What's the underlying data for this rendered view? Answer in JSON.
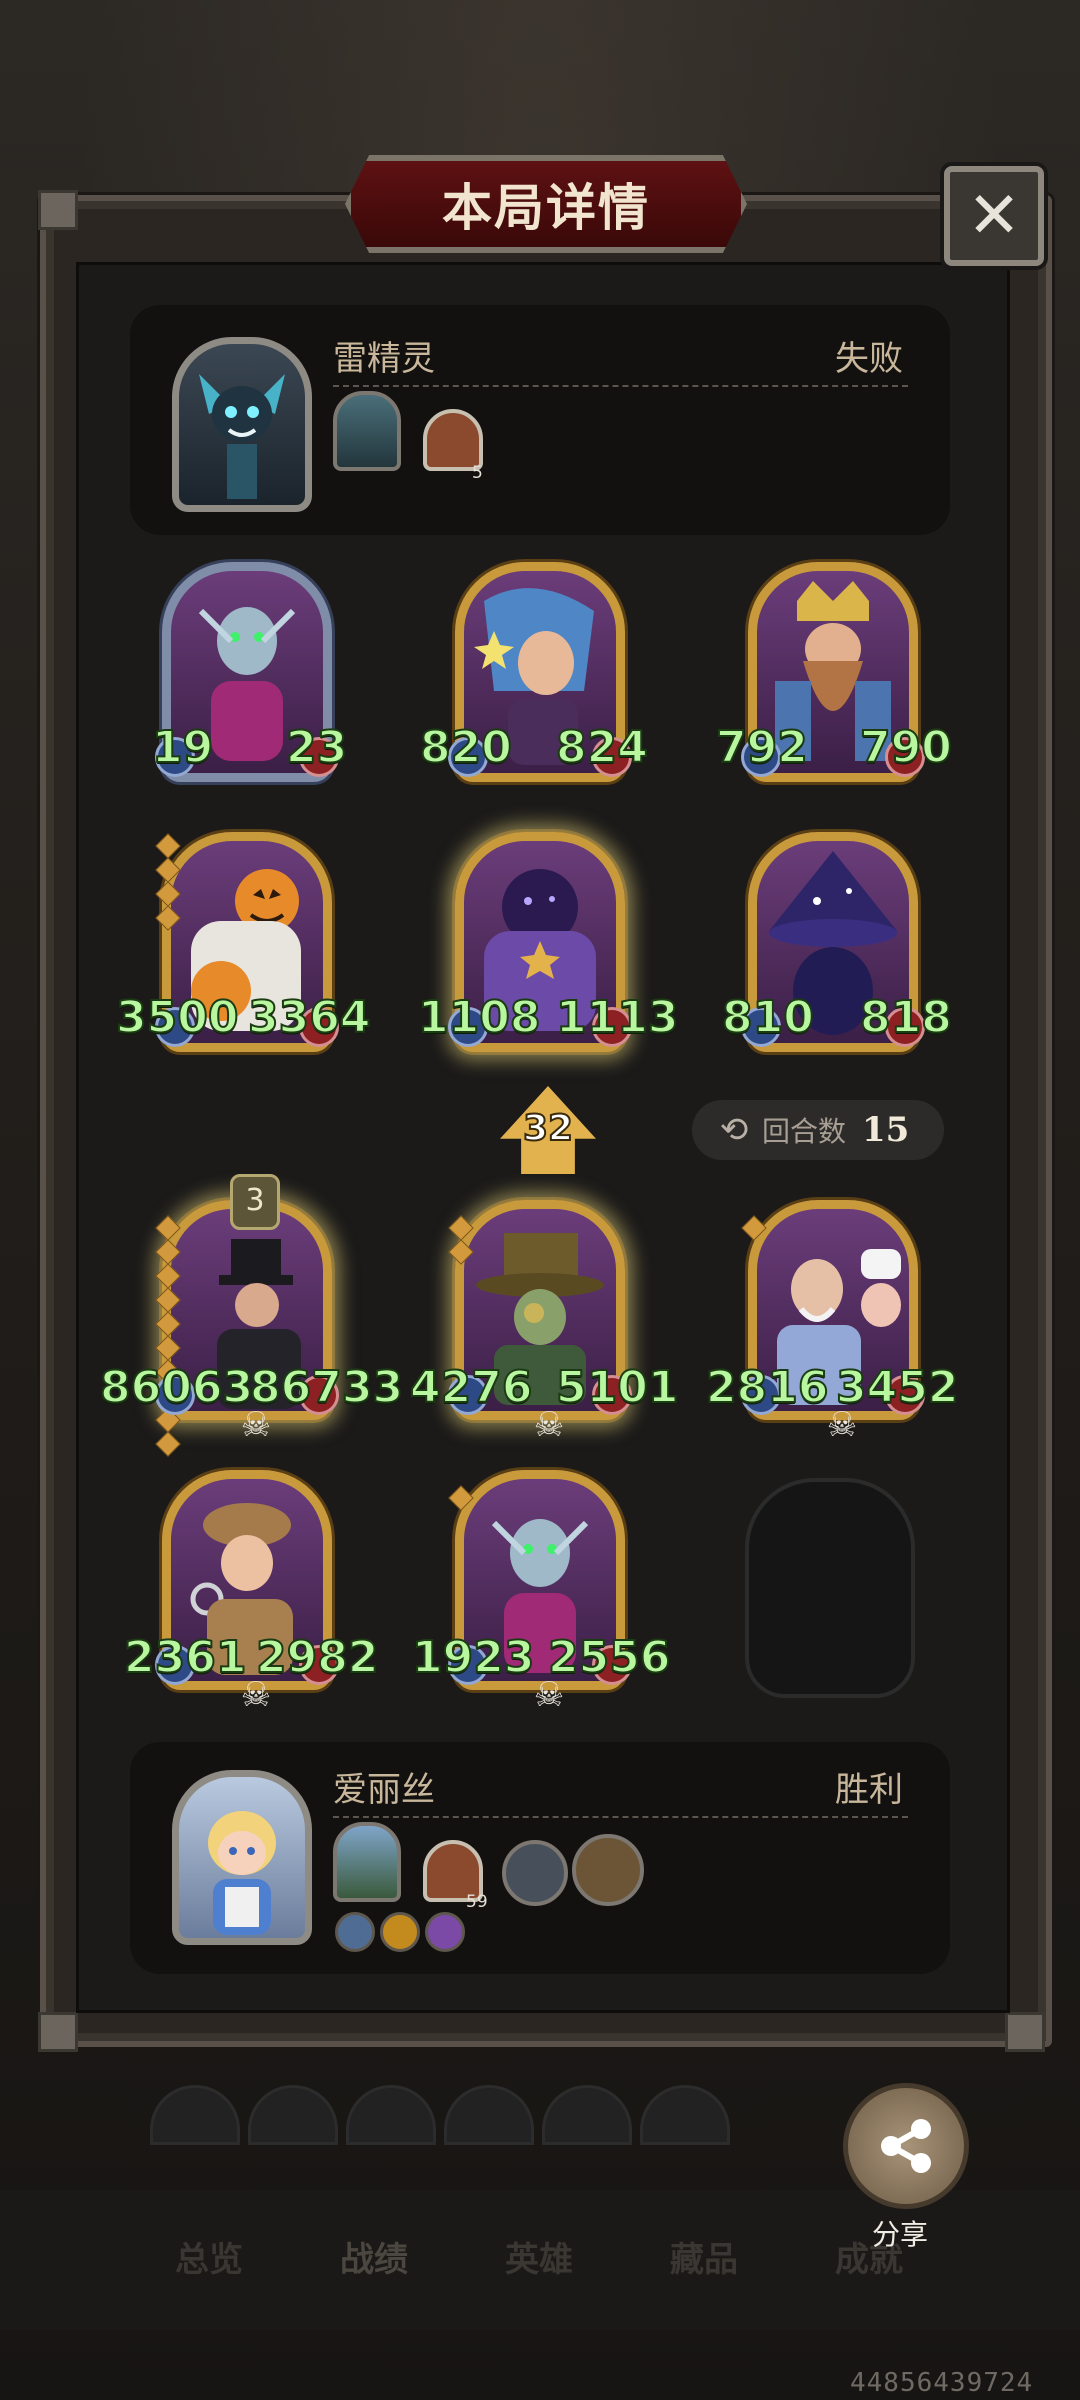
{
  "header": {
    "title": "本局详情",
    "close_icon": "close-icon"
  },
  "opponent": {
    "name": "雷精灵",
    "result": "失败",
    "items": [
      {
        "icon": "shadow-statue-icon"
      },
      {
        "icon": "house-icon",
        "count": "5"
      }
    ]
  },
  "opponent_board": [
    {
      "atk": "19",
      "hp": "23"
    },
    {
      "atk": "820",
      "hp": "824"
    },
    {
      "atk": "792",
      "hp": "790"
    },
    {
      "atk": "3500",
      "hp": "3364"
    },
    {
      "atk": "1108",
      "hp": "1113"
    },
    {
      "atk": "810",
      "hp": "818"
    }
  ],
  "middle": {
    "arrow_value": "32",
    "turns_label": "回合数",
    "turns_value": "15"
  },
  "player_board": [
    {
      "atk": "86063",
      "hp": "86733",
      "level": "3"
    },
    {
      "atk": "4276",
      "hp": "5101"
    },
    {
      "atk": "2816",
      "hp": "3452"
    },
    {
      "atk": "2361",
      "hp": "2982"
    },
    {
      "atk": "1923",
      "hp": "2556"
    }
  ],
  "player": {
    "name": "爱丽丝",
    "result": "胜利",
    "items": [
      {
        "icon": "tree-statue-icon"
      },
      {
        "icon": "house-icon",
        "count": "59"
      },
      {
        "icon": "pocket-watch-icon"
      },
      {
        "icon": "treasure-chest-icon"
      }
    ]
  },
  "share": {
    "label": "分享"
  },
  "bottom_nav": {
    "tabs": [
      "总览",
      "战绩",
      "英雄",
      "藏品",
      "成就"
    ],
    "active": "战绩"
  },
  "version": "44856439724"
}
